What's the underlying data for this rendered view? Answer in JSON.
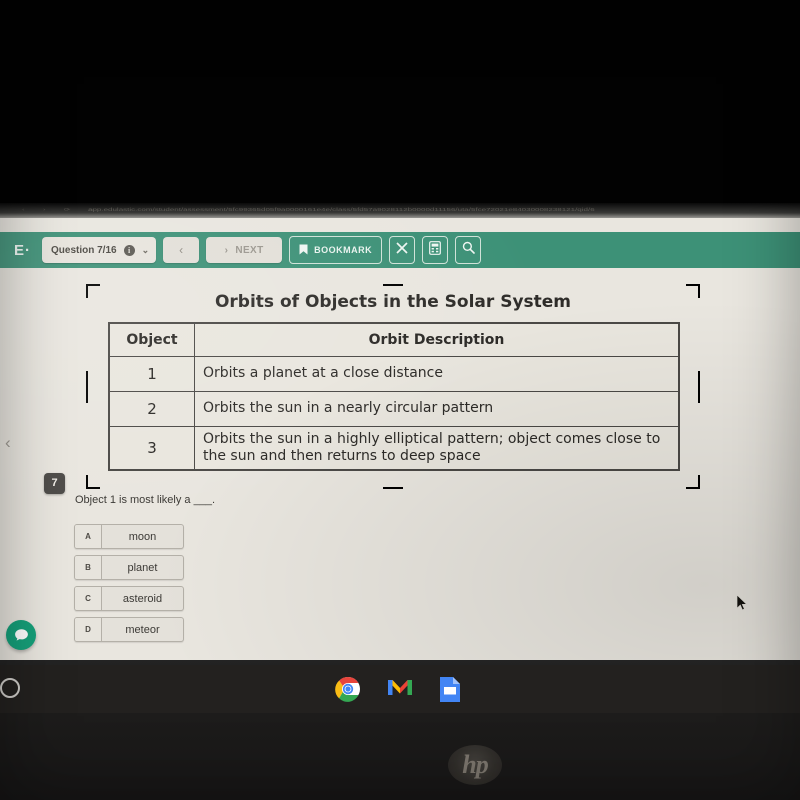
{
  "browser": {
    "url": "app.edulastic.com/student/assessment/5fc99365d05f9a0000161e4e/class/5fd57a9028112b0000d11156/uta/5fce72021e84030008238121/qid/6",
    "url_icons": "‹ › ⟳ ⌂"
  },
  "toolbar": {
    "brand": "E·",
    "question_counter": "Question 7/16",
    "info_icon": "i",
    "chevron_icon": "⌄",
    "prev_label": "‹",
    "next_arrow": "›",
    "next_label": "NEXT",
    "bookmark_icon": "🔖",
    "bookmark_label": "BOOKMARK",
    "eliminate_icon": "✕",
    "calculator_icon": "calculator",
    "search_icon": "🔍"
  },
  "rail": {
    "collapse_chevron": "‹",
    "question_number": "7"
  },
  "stimulus": {
    "title": "Orbits of Objects in the Solar System",
    "columns": [
      "Object",
      "Orbit Description"
    ],
    "rows": [
      {
        "object": "1",
        "description": "Orbits a planet at a close distance"
      },
      {
        "object": "2",
        "description": "Orbits the sun in a nearly circular pattern"
      },
      {
        "object": "3",
        "description": "Orbits the sun in a highly elliptical pattern; object comes close to the sun and then returns to deep space"
      }
    ]
  },
  "question": {
    "prompt": "Object 1 is most likely a ___.",
    "choices": [
      {
        "letter": "A",
        "label": "moon"
      },
      {
        "letter": "B",
        "label": "planet"
      },
      {
        "letter": "C",
        "label": "asteroid"
      },
      {
        "letter": "D",
        "label": "meteor"
      }
    ]
  },
  "help": {
    "icon": "chat-bubble"
  },
  "shelf": {
    "launcher": "○",
    "apps": [
      {
        "name": "chrome",
        "label": "Chrome"
      },
      {
        "name": "gmail",
        "label": "M"
      },
      {
        "name": "slides",
        "label": "Slides"
      }
    ]
  },
  "device": {
    "brand": "hp"
  },
  "colors": {
    "toolbar_teal": "#3d9177",
    "page_bg": "#e9e6df",
    "badge_dark": "#4c4a47",
    "help_green": "#16a07a",
    "table_border": "#4a4845"
  }
}
